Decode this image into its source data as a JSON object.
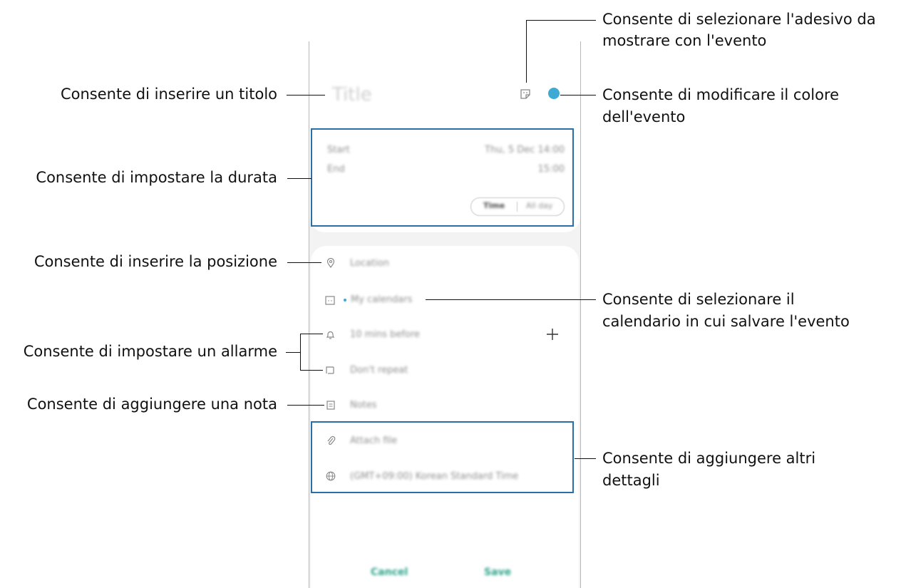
{
  "screen": {
    "title_placeholder": "Title",
    "start_label": "Start",
    "start_value": "Thu, 5 Dec  14:00",
    "end_label": "End",
    "end_value": "15:00",
    "toggle_time": "Time",
    "toggle_allday": "All day",
    "location": "Location",
    "calendar": "My calendars",
    "alarm": "10 mins before",
    "repeat": "Don't repeat",
    "notes": "Notes",
    "attach": "Attach file",
    "timezone": "(GMT+09:00) Korean Standard Time",
    "cancel": "Cancel",
    "save": "Save",
    "event_color": "#3fa9d6"
  },
  "callouts": {
    "title": "Consente di inserire un titolo",
    "duration": "Consente di impostare la durata",
    "location": "Consente di inserire la posizione",
    "alarm": "Consente di impostare un allarme",
    "note": "Consente di aggiungere una nota",
    "sticker_line1": "Consente di selezionare l'adesivo da",
    "sticker_line2": "mostrare con l'evento",
    "color_line1": "Consente di modificare il colore",
    "color_line2": "dell'evento",
    "calendar_line1": "Consente di selezionare il",
    "calendar_line2": "calendario in cui salvare l'evento",
    "details_line1": "Consente di aggiungere altri",
    "details_line2": "dettagli"
  }
}
